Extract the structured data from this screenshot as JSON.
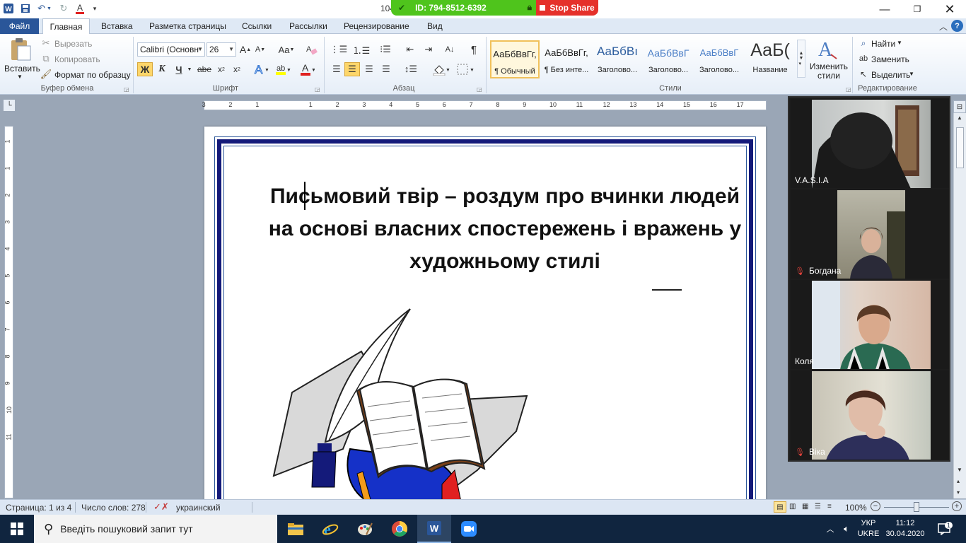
{
  "title_bar": {
    "doc_title": "104",
    "zoom": {
      "meeting_id": "ID: 794-8512-6392",
      "stop_share": "Stop Share"
    }
  },
  "ribbon_tabs": [
    "Файл",
    "Главная",
    "Вставка",
    "Разметка страницы",
    "Ссылки",
    "Рассылки",
    "Рецензирование",
    "Вид"
  ],
  "clipboard": {
    "paste": "Вставить",
    "cut": "Вырезать",
    "copy": "Копировать",
    "format_painter": "Формат по образцу",
    "label": "Буфер обмена"
  },
  "font": {
    "family": "Calibri (Основн",
    "size": "26",
    "label": "Шрифт",
    "bold": "Ж",
    "italic": "К",
    "underline": "Ч",
    "strike": "abe",
    "grow": "A",
    "shrink": "A",
    "case": "Aa"
  },
  "paragraph": {
    "label": "Абзац"
  },
  "styles": {
    "label": "Стили",
    "items": [
      {
        "preview": "АаБбВвГг,",
        "name": "¶ Обычный"
      },
      {
        "preview": "АаБбВвГг,",
        "name": "¶ Без инте..."
      },
      {
        "preview": "АаБбВı",
        "name": "Заголово..."
      },
      {
        "preview": "АаБбВвГ",
        "name": "Заголово..."
      },
      {
        "preview": "АаБбВвГ",
        "name": "Заголово..."
      },
      {
        "preview": "АаБ(",
        "name": "Название"
      }
    ],
    "change_styles": "Изменить стили"
  },
  "editing": {
    "label": "Редактирование",
    "find": "Найти",
    "replace": "Заменить",
    "select": "Выделить"
  },
  "ruler": {
    "h_labels": [
      "3",
      "2",
      "1",
      "1",
      "2",
      "3",
      "4",
      "5",
      "6",
      "7",
      "8",
      "9",
      "10",
      "11",
      "12",
      "13",
      "14",
      "15",
      "16",
      "17"
    ],
    "v_labels": [
      "1",
      "1",
      "2",
      "3",
      "4",
      "5",
      "6",
      "7",
      "8",
      "9",
      "10",
      "11"
    ]
  },
  "document": {
    "heading": "Письмовий твір – роздум про вчинки людей на основі власних спостережень і вражень у художньому стилі"
  },
  "participants": [
    {
      "name": "V.A.S.I.A",
      "muted": false
    },
    {
      "name": "Богдана",
      "muted": true
    },
    {
      "name": "Коля",
      "muted": false
    },
    {
      "name": "Віка",
      "muted": true
    }
  ],
  "status_bar": {
    "page": "Страница: 1 из 4",
    "words": "Число слов: 278",
    "language": "украинский",
    "zoom": "100%"
  },
  "taskbar": {
    "search_placeholder": "Введіть пошуковий запит тут",
    "lang_top": "УКР",
    "lang_bottom": "UKRE",
    "time": "11:12",
    "date": "30.04.2020",
    "notifications": "1"
  },
  "colors": {
    "file_tab": "#2a5699",
    "frame": "#141a7a",
    "zoom_green": "#4fc41c",
    "zoom_red": "#e5312b",
    "taskbar": "#10253f"
  }
}
